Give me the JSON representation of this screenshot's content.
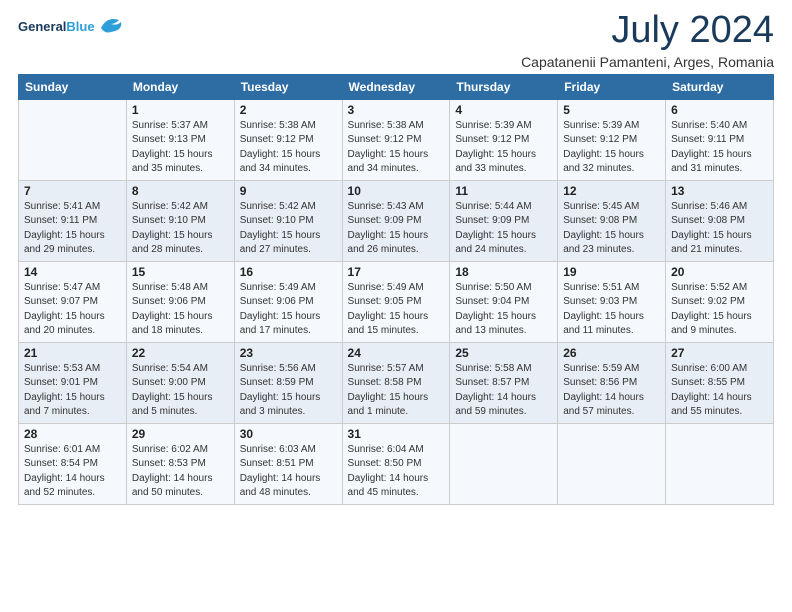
{
  "logo": {
    "general": "General",
    "blue": "Blue"
  },
  "header": {
    "month": "July 2024",
    "location": "Capatanenii Pamanteni, Arges, Romania"
  },
  "days_of_week": [
    "Sunday",
    "Monday",
    "Tuesday",
    "Wednesday",
    "Thursday",
    "Friday",
    "Saturday"
  ],
  "weeks": [
    [
      {
        "day": "",
        "sunrise": "",
        "sunset": "",
        "daylight": ""
      },
      {
        "day": "1",
        "sunrise": "Sunrise: 5:37 AM",
        "sunset": "Sunset: 9:13 PM",
        "daylight": "Daylight: 15 hours and 35 minutes."
      },
      {
        "day": "2",
        "sunrise": "Sunrise: 5:38 AM",
        "sunset": "Sunset: 9:12 PM",
        "daylight": "Daylight: 15 hours and 34 minutes."
      },
      {
        "day": "3",
        "sunrise": "Sunrise: 5:38 AM",
        "sunset": "Sunset: 9:12 PM",
        "daylight": "Daylight: 15 hours and 34 minutes."
      },
      {
        "day": "4",
        "sunrise": "Sunrise: 5:39 AM",
        "sunset": "Sunset: 9:12 PM",
        "daylight": "Daylight: 15 hours and 33 minutes."
      },
      {
        "day": "5",
        "sunrise": "Sunrise: 5:39 AM",
        "sunset": "Sunset: 9:12 PM",
        "daylight": "Daylight: 15 hours and 32 minutes."
      },
      {
        "day": "6",
        "sunrise": "Sunrise: 5:40 AM",
        "sunset": "Sunset: 9:11 PM",
        "daylight": "Daylight: 15 hours and 31 minutes."
      }
    ],
    [
      {
        "day": "7",
        "sunrise": "Sunrise: 5:41 AM",
        "sunset": "Sunset: 9:11 PM",
        "daylight": "Daylight: 15 hours and 29 minutes."
      },
      {
        "day": "8",
        "sunrise": "Sunrise: 5:42 AM",
        "sunset": "Sunset: 9:10 PM",
        "daylight": "Daylight: 15 hours and 28 minutes."
      },
      {
        "day": "9",
        "sunrise": "Sunrise: 5:42 AM",
        "sunset": "Sunset: 9:10 PM",
        "daylight": "Daylight: 15 hours and 27 minutes."
      },
      {
        "day": "10",
        "sunrise": "Sunrise: 5:43 AM",
        "sunset": "Sunset: 9:09 PM",
        "daylight": "Daylight: 15 hours and 26 minutes."
      },
      {
        "day": "11",
        "sunrise": "Sunrise: 5:44 AM",
        "sunset": "Sunset: 9:09 PM",
        "daylight": "Daylight: 15 hours and 24 minutes."
      },
      {
        "day": "12",
        "sunrise": "Sunrise: 5:45 AM",
        "sunset": "Sunset: 9:08 PM",
        "daylight": "Daylight: 15 hours and 23 minutes."
      },
      {
        "day": "13",
        "sunrise": "Sunrise: 5:46 AM",
        "sunset": "Sunset: 9:08 PM",
        "daylight": "Daylight: 15 hours and 21 minutes."
      }
    ],
    [
      {
        "day": "14",
        "sunrise": "Sunrise: 5:47 AM",
        "sunset": "Sunset: 9:07 PM",
        "daylight": "Daylight: 15 hours and 20 minutes."
      },
      {
        "day": "15",
        "sunrise": "Sunrise: 5:48 AM",
        "sunset": "Sunset: 9:06 PM",
        "daylight": "Daylight: 15 hours and 18 minutes."
      },
      {
        "day": "16",
        "sunrise": "Sunrise: 5:49 AM",
        "sunset": "Sunset: 9:06 PM",
        "daylight": "Daylight: 15 hours and 17 minutes."
      },
      {
        "day": "17",
        "sunrise": "Sunrise: 5:49 AM",
        "sunset": "Sunset: 9:05 PM",
        "daylight": "Daylight: 15 hours and 15 minutes."
      },
      {
        "day": "18",
        "sunrise": "Sunrise: 5:50 AM",
        "sunset": "Sunset: 9:04 PM",
        "daylight": "Daylight: 15 hours and 13 minutes."
      },
      {
        "day": "19",
        "sunrise": "Sunrise: 5:51 AM",
        "sunset": "Sunset: 9:03 PM",
        "daylight": "Daylight: 15 hours and 11 minutes."
      },
      {
        "day": "20",
        "sunrise": "Sunrise: 5:52 AM",
        "sunset": "Sunset: 9:02 PM",
        "daylight": "Daylight: 15 hours and 9 minutes."
      }
    ],
    [
      {
        "day": "21",
        "sunrise": "Sunrise: 5:53 AM",
        "sunset": "Sunset: 9:01 PM",
        "daylight": "Daylight: 15 hours and 7 minutes."
      },
      {
        "day": "22",
        "sunrise": "Sunrise: 5:54 AM",
        "sunset": "Sunset: 9:00 PM",
        "daylight": "Daylight: 15 hours and 5 minutes."
      },
      {
        "day": "23",
        "sunrise": "Sunrise: 5:56 AM",
        "sunset": "Sunset: 8:59 PM",
        "daylight": "Daylight: 15 hours and 3 minutes."
      },
      {
        "day": "24",
        "sunrise": "Sunrise: 5:57 AM",
        "sunset": "Sunset: 8:58 PM",
        "daylight": "Daylight: 15 hours and 1 minute."
      },
      {
        "day": "25",
        "sunrise": "Sunrise: 5:58 AM",
        "sunset": "Sunset: 8:57 PM",
        "daylight": "Daylight: 14 hours and 59 minutes."
      },
      {
        "day": "26",
        "sunrise": "Sunrise: 5:59 AM",
        "sunset": "Sunset: 8:56 PM",
        "daylight": "Daylight: 14 hours and 57 minutes."
      },
      {
        "day": "27",
        "sunrise": "Sunrise: 6:00 AM",
        "sunset": "Sunset: 8:55 PM",
        "daylight": "Daylight: 14 hours and 55 minutes."
      }
    ],
    [
      {
        "day": "28",
        "sunrise": "Sunrise: 6:01 AM",
        "sunset": "Sunset: 8:54 PM",
        "daylight": "Daylight: 14 hours and 52 minutes."
      },
      {
        "day": "29",
        "sunrise": "Sunrise: 6:02 AM",
        "sunset": "Sunset: 8:53 PM",
        "daylight": "Daylight: 14 hours and 50 minutes."
      },
      {
        "day": "30",
        "sunrise": "Sunrise: 6:03 AM",
        "sunset": "Sunset: 8:51 PM",
        "daylight": "Daylight: 14 hours and 48 minutes."
      },
      {
        "day": "31",
        "sunrise": "Sunrise: 6:04 AM",
        "sunset": "Sunset: 8:50 PM",
        "daylight": "Daylight: 14 hours and 45 minutes."
      },
      {
        "day": "",
        "sunrise": "",
        "sunset": "",
        "daylight": ""
      },
      {
        "day": "",
        "sunrise": "",
        "sunset": "",
        "daylight": ""
      },
      {
        "day": "",
        "sunrise": "",
        "sunset": "",
        "daylight": ""
      }
    ]
  ]
}
